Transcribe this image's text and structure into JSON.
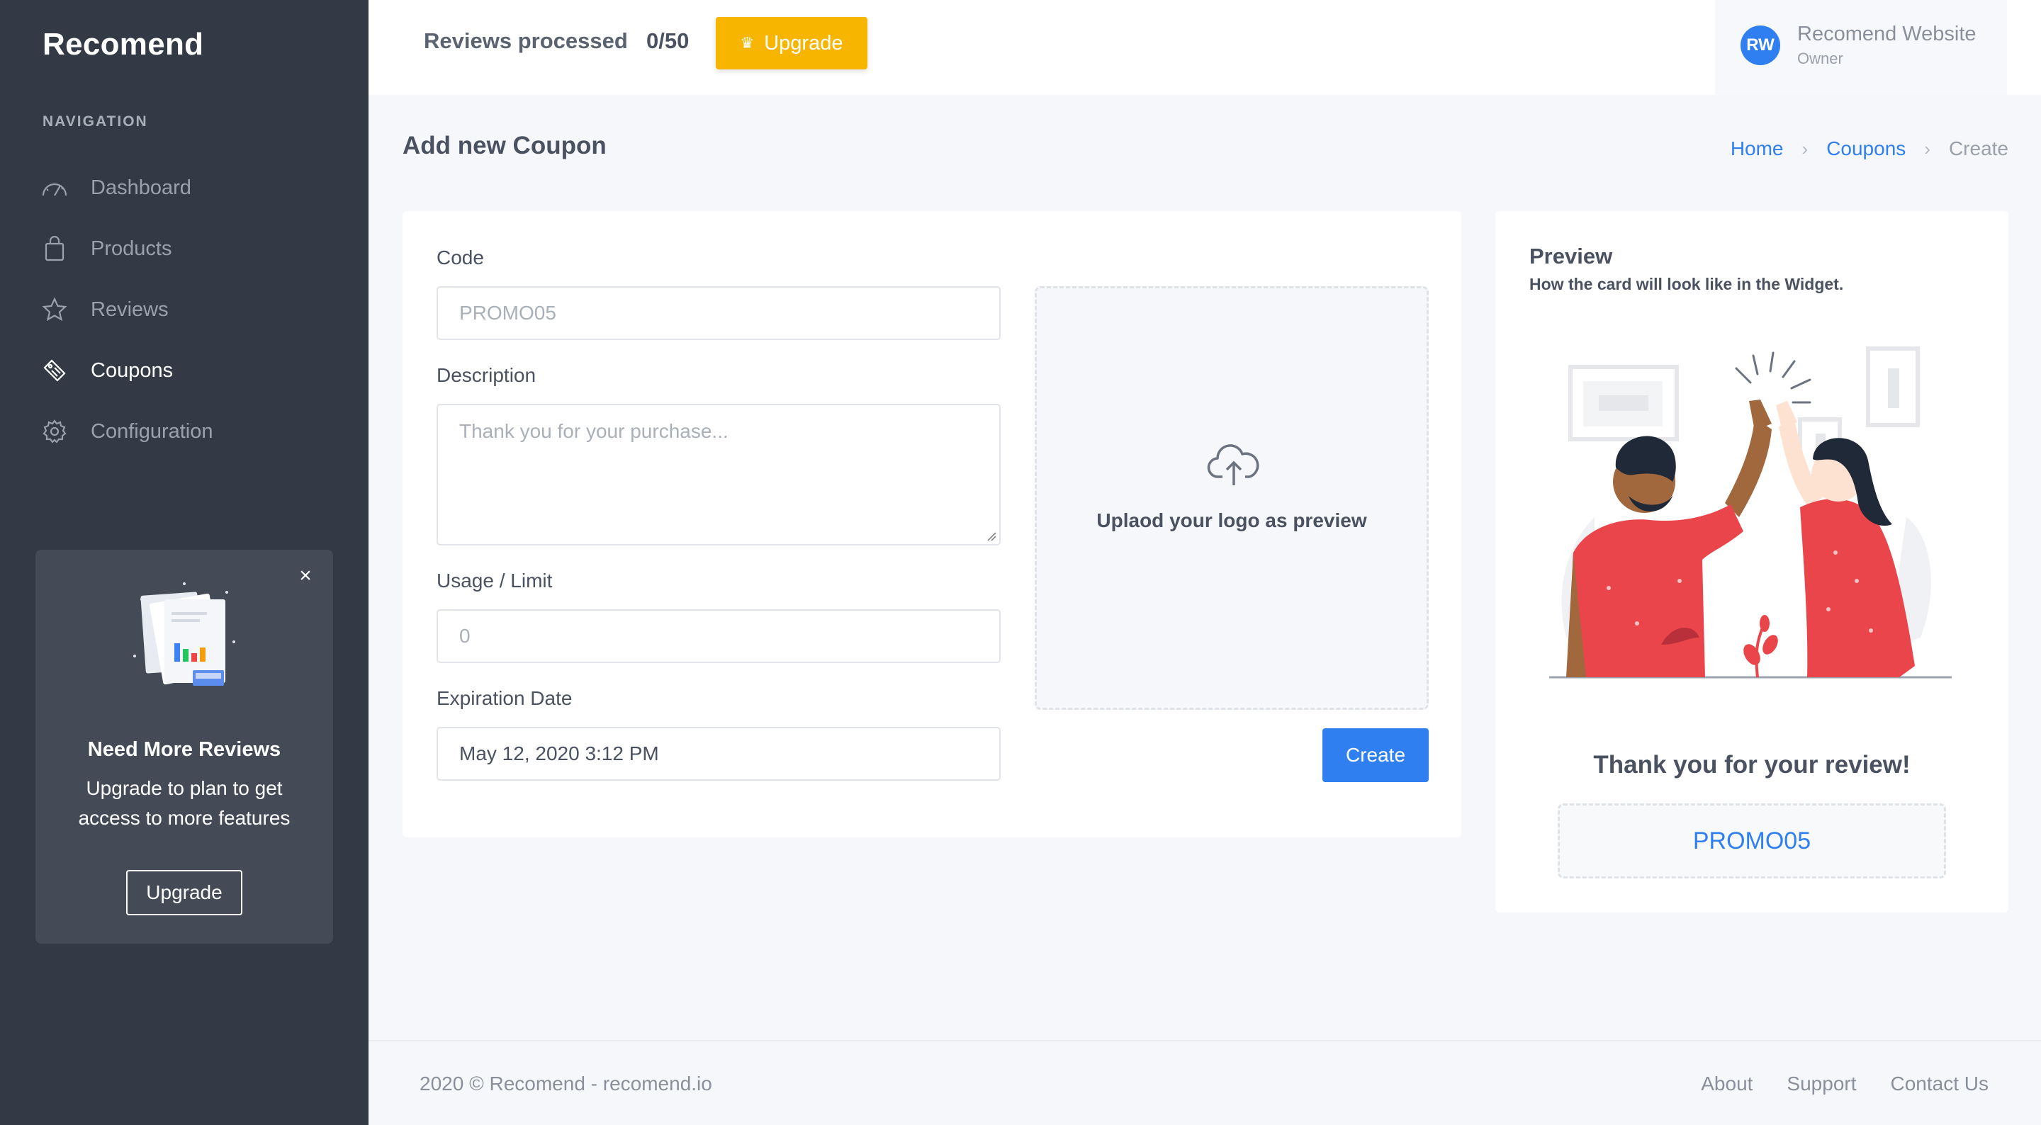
{
  "app": {
    "brand": "Recomend"
  },
  "sidebar": {
    "heading": "NAVIGATION",
    "items": [
      {
        "label": "Dashboard",
        "icon": "gauge-icon",
        "active": false
      },
      {
        "label": "Products",
        "icon": "bag-icon",
        "active": false
      },
      {
        "label": "Reviews",
        "icon": "star-icon",
        "active": false
      },
      {
        "label": "Coupons",
        "icon": "ticket-icon",
        "active": true
      },
      {
        "label": "Configuration",
        "icon": "gear-icon",
        "active": false
      }
    ],
    "promo": {
      "title": "Need More Reviews",
      "text": "Upgrade to plan to get access to more features",
      "button": "Upgrade",
      "close": "×"
    }
  },
  "topbar": {
    "reviews_label": "Reviews processed",
    "reviews_count": "0/50",
    "upgrade_label": "Upgrade",
    "user": {
      "initials": "RW",
      "name": "Recomend Website",
      "role": "Owner"
    }
  },
  "page": {
    "title": "Add new Coupon",
    "breadcrumb": [
      "Home",
      "Coupons",
      "Create"
    ]
  },
  "form": {
    "code": {
      "label": "Code",
      "placeholder": "PROMO05"
    },
    "description": {
      "label": "Description",
      "placeholder": "Thank you for your purchase..."
    },
    "usage": {
      "label": "Usage / Limit",
      "placeholder": "0"
    },
    "expiration": {
      "label": "Expiration Date",
      "value": "May 12, 2020 3:12 PM"
    },
    "upload_text": "Uplaod your logo as preview",
    "create_label": "Create"
  },
  "preview": {
    "title": "Preview",
    "subtitle": "How the card will look like in the Widget.",
    "thanks": "Thank you for your review!",
    "code": "PROMO05"
  },
  "footer": {
    "copyright": "2020 © Recomend - recomend.io",
    "links": [
      "About",
      "Support",
      "Contact Us"
    ]
  },
  "colors": {
    "sidebar_bg": "#333a45",
    "accent_blue": "#2f7ff0",
    "upgrade_yellow": "#f7b500",
    "illustration_red": "#e9454a"
  }
}
